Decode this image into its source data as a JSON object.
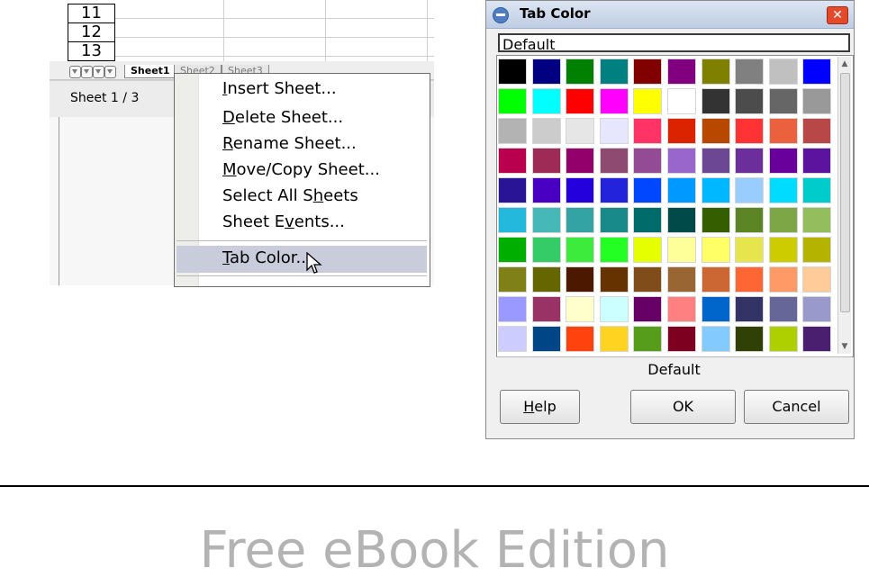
{
  "spreadsheet": {
    "row_headers": [
      "11",
      "12",
      "13"
    ],
    "tabs": [
      "Sheet1",
      "Sheet2",
      "Sheet3"
    ],
    "status": "Sheet 1 / 3"
  },
  "context_menu": {
    "items": [
      {
        "pre": "",
        "key": "I",
        "post": "nsert Sheet..."
      },
      {
        "pre": "",
        "key": "D",
        "post": "elete Sheet..."
      },
      {
        "pre": "",
        "key": "R",
        "post": "ename Sheet..."
      },
      {
        "pre": "",
        "key": "M",
        "post": "ove/Copy Sheet..."
      },
      {
        "pre": "Select All S",
        "key": "h",
        "post": "eets"
      },
      {
        "pre": "Sheet E",
        "key": "v",
        "post": "ents..."
      }
    ],
    "highlighted": {
      "pre": "",
      "key": "T",
      "post": "ab Color..."
    }
  },
  "dialog": {
    "title": "Tab Color",
    "close_label": "✕",
    "name_value": "Default",
    "selected_color_label": "Default",
    "palette": [
      [
        "#000000",
        "#000080",
        "#008000",
        "#008080",
        "#800000",
        "#800080",
        "#808000",
        "#808080",
        "#c0c0c0",
        "#0000ff"
      ],
      [
        "#00ff00",
        "#00ffff",
        "#ff0000",
        "#ff00ff",
        "#ffff00",
        "#ffffff",
        "#333333",
        "#4c4c4c",
        "#666666",
        "#999999"
      ],
      [
        "#b3b3b3",
        "#cccccc",
        "#e6e6e6",
        "#e6e6ff",
        "#ff3366",
        "#dc2300",
        "#b84700",
        "#ff3333",
        "#eb613d",
        "#b84747"
      ],
      [
        "#b8004f",
        "#9e2a56",
        "#94006b",
        "#8f4a71",
        "#934b95",
        "#9966cc",
        "#6b4794",
        "#6b2e9a",
        "#69009b",
        "#5c149f"
      ],
      [
        "#2a1496",
        "#4900c2",
        "#2300dc",
        "#2323dc",
        "#0047ff",
        "#0099ff",
        "#00b8ff",
        "#99ccff",
        "#00dcff",
        "#00cccc"
      ],
      [
        "#23b8dc",
        "#47b8b8",
        "#33a3a3",
        "#198a8a",
        "#006b6b",
        "#004a4a",
        "#355e00",
        "#5c8526",
        "#7da647",
        "#94bd5e"
      ],
      [
        "#00ae00",
        "#33cc66",
        "#3deb3d",
        "#23ff23",
        "#e6ff00",
        "#ffff99",
        "#ffff66",
        "#e6e64c",
        "#cccc00",
        "#b3b300"
      ],
      [
        "#808019",
        "#666600",
        "#4c1900",
        "#663300",
        "#804c19",
        "#996633",
        "#cc6633",
        "#ff6633",
        "#ff9966",
        "#ffcc99"
      ],
      [
        "#9999ff",
        "#993366",
        "#ffffcc",
        "#ccffff",
        "#660066",
        "#ff8080",
        "#0066cc",
        "#333366",
        "#666699",
        "#9999cc"
      ],
      [
        "#ccccff",
        "#004586",
        "#ff420e",
        "#ffd320",
        "#579d1c",
        "#7e0021",
        "#83caff",
        "#314004",
        "#aecf00",
        "#4b1f6f"
      ]
    ],
    "buttons": {
      "help": {
        "pre": "",
        "key": "H",
        "post": "elp"
      },
      "ok": "OK",
      "cancel": "Cancel"
    }
  },
  "footer": {
    "edition": "Free eBook Edition"
  }
}
